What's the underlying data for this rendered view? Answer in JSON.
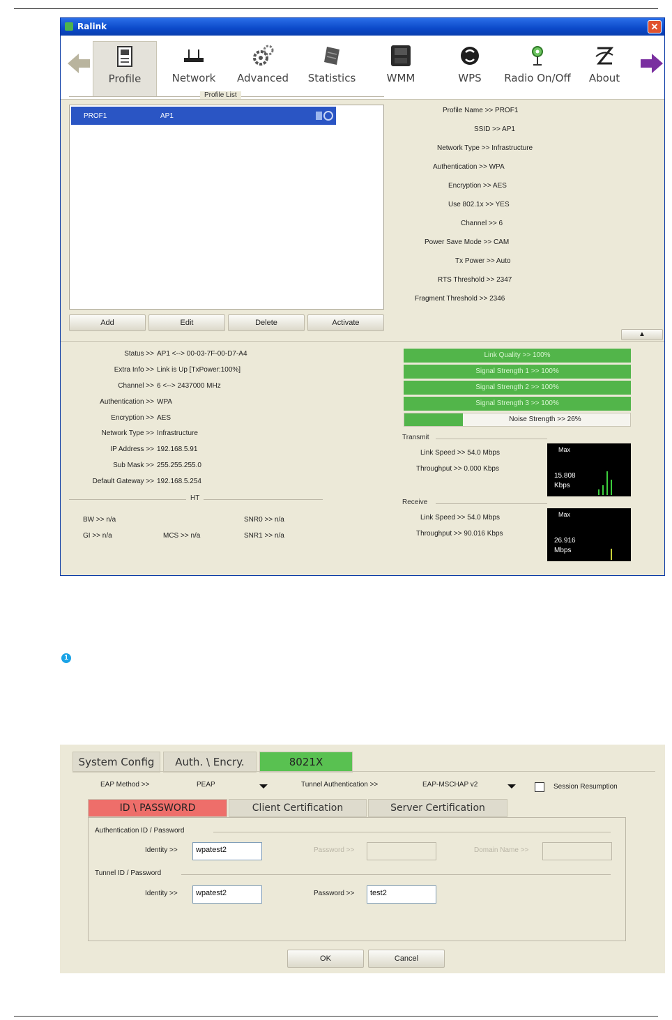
{
  "window": {
    "title": "Ralink",
    "toolbar": [
      {
        "label": "Profile",
        "icon": "profile-icon",
        "active": true
      },
      {
        "label": "Network",
        "icon": "network-icon"
      },
      {
        "label": "Advanced",
        "icon": "advanced-icon"
      },
      {
        "label": "Statistics",
        "icon": "statistics-icon"
      },
      {
        "label": "WMM",
        "icon": "wmm-icon"
      },
      {
        "label": "WPS",
        "icon": "wps-icon"
      },
      {
        "label": "Radio On/Off",
        "icon": "radio-icon"
      },
      {
        "label": "About",
        "icon": "about-icon"
      }
    ],
    "profile_list_title": "Profile List",
    "profile_rows": [
      {
        "name": "PROF1",
        "ssid": "AP1"
      }
    ],
    "buttons": {
      "add": "Add",
      "edit": "Edit",
      "delete": "Delete",
      "activate": "Activate"
    },
    "profile_details": [
      "Profile Name >> PROF1",
      "SSID >> AP1",
      "Network Type >> Infrastructure",
      "Authentication >> WPA",
      "Encryption >> AES",
      "Use 802.1x >> YES",
      "Channel >> 6",
      "Power Save Mode >> CAM",
      "Tx Power >> Auto",
      "RTS Threshold >> 2347",
      "Fragment Threshold >> 2346"
    ],
    "status": [
      {
        "label": "Status >>",
        "value": "AP1 <--> 00-03-7F-00-D7-A4"
      },
      {
        "label": "Extra Info >>",
        "value": "Link is Up [TxPower:100%]"
      },
      {
        "label": "Channel >>",
        "value": "6 <--> 2437000 MHz"
      },
      {
        "label": "Authentication >>",
        "value": "WPA"
      },
      {
        "label": "Encryption >>",
        "value": "AES"
      },
      {
        "label": "Network Type >>",
        "value": "Infrastructure"
      },
      {
        "label": "IP Address >>",
        "value": "192.168.5.91"
      },
      {
        "label": "Sub Mask >>",
        "value": "255.255.255.0"
      },
      {
        "label": "Default Gateway >>",
        "value": "192.168.5.254"
      }
    ],
    "ht": {
      "title": "HT",
      "bw": "BW >> n/a",
      "gi": "GI >> n/a",
      "mcs": "MCS >> n/a",
      "snr0": "SNR0 >> n/a",
      "snr1": "SNR1 >> n/a"
    },
    "signal_bars": [
      {
        "text": "Link Quality >> 100%",
        "level": 100
      },
      {
        "text": "Signal Strength 1 >> 100%",
        "level": 100
      },
      {
        "text": "Signal Strength 2 >> 100%",
        "level": 100
      },
      {
        "text": "Signal Strength 3 >> 100%",
        "level": 100
      }
    ],
    "noise": {
      "text": "Noise Strength >> 26%",
      "level": 26
    },
    "transmit": {
      "title": "Transmit",
      "link_speed": "Link Speed >> 54.0 Mbps",
      "throughput": "Throughput >> 0.000 Kbps",
      "graph_max": "Max",
      "graph_value": "15.808",
      "graph_unit": "Kbps"
    },
    "receive": {
      "title": "Receive",
      "link_speed": "Link Speed >> 54.0 Mbps",
      "throughput": "Throughput >> 90.016 Kbps",
      "graph_max": "Max",
      "graph_value": "26.916",
      "graph_unit": "Mbps"
    }
  },
  "callout": {
    "number": "1"
  },
  "dialog": {
    "tabs": [
      {
        "label": "System Config"
      },
      {
        "label": "Auth. \\ Encry."
      },
      {
        "label": "8021X",
        "active": true
      }
    ],
    "eap_method_label": "EAP Method >>",
    "eap_method_value": "PEAP",
    "tunnel_auth_label": "Tunnel Authentication >>",
    "tunnel_auth_value": "EAP-MSCHAP v2",
    "session_resumption": "Session Resumption",
    "subtabs": [
      {
        "label": "ID \\ PASSWORD",
        "active": true
      },
      {
        "label": "Client Certification"
      },
      {
        "label": "Server Certification"
      }
    ],
    "auth_group": "Authentication ID / Password",
    "identity_label": "Identity >>",
    "identity_value": "wpatest2",
    "password_label": "Password >>",
    "domain_label": "Domain Name >>",
    "tunnel_group": "Tunnel ID / Password",
    "tunnel_identity_label": "Identity >>",
    "tunnel_identity_value": "wpatest2",
    "tunnel_password_label": "Password >>",
    "tunnel_password_value": "test2",
    "ok": "OK",
    "cancel": "Cancel"
  }
}
